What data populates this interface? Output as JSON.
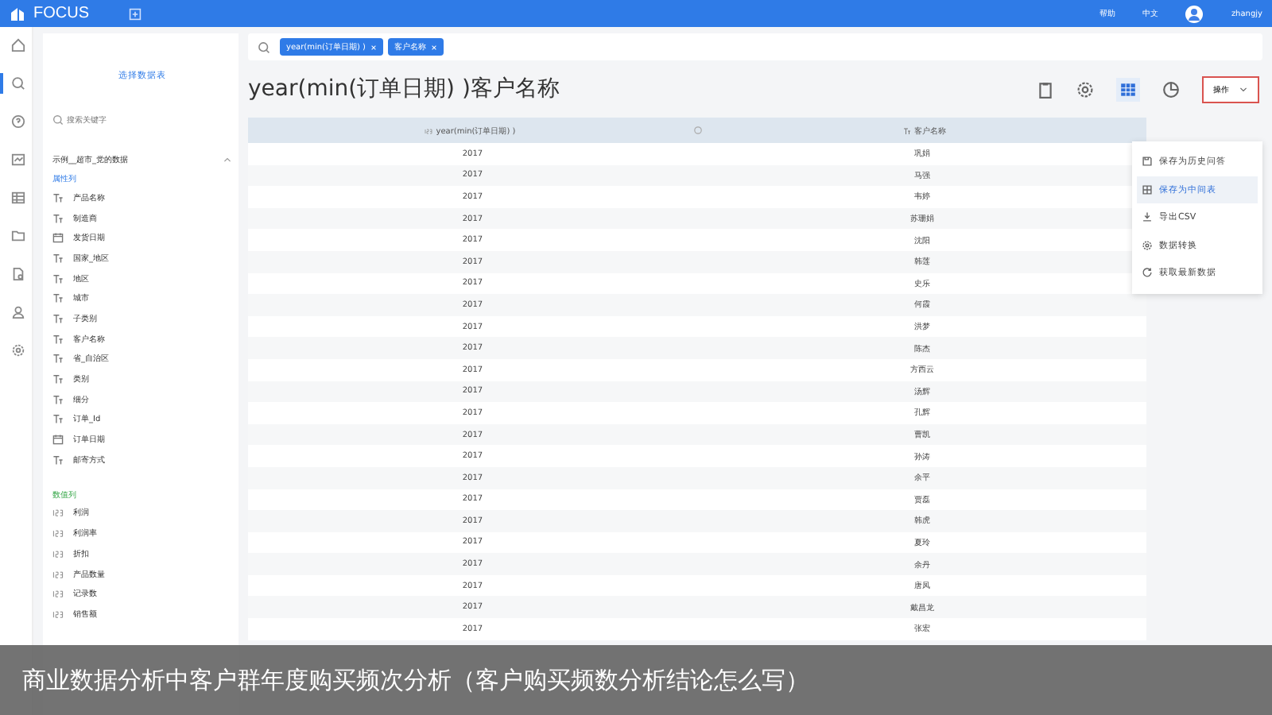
{
  "topbar": {
    "logo": "FOCUS",
    "links": [
      "帮助",
      "中文"
    ],
    "user": "zhangjy"
  },
  "nav": [
    {
      "selected": false
    },
    {
      "selected": true
    },
    {
      "selected": false
    },
    {
      "selected": false
    },
    {
      "selected": false
    },
    {
      "selected": false
    },
    {
      "selected": false
    },
    {
      "selected": false
    },
    {
      "selected": false
    }
  ],
  "datasource": {
    "button": "选择数据表",
    "search_placeholder": "搜索关键字",
    "table_name": "示例__超市_党的数据",
    "sections": [
      {
        "label": "属性列",
        "kind": "attr",
        "fields": [
          {
            "name": "产品名称",
            "kind": "text"
          },
          {
            "name": "制造商",
            "kind": "text"
          },
          {
            "name": "发货日期",
            "kind": "date"
          },
          {
            "name": "国家_地区",
            "kind": "text"
          },
          {
            "name": "地区",
            "kind": "text"
          },
          {
            "name": "城市",
            "kind": "text"
          },
          {
            "name": "子类别",
            "kind": "text"
          },
          {
            "name": "客户名称",
            "kind": "text"
          },
          {
            "name": "省_自治区",
            "kind": "text"
          },
          {
            "name": "类别",
            "kind": "text"
          },
          {
            "name": "细分",
            "kind": "text"
          },
          {
            "name": "订单_Id",
            "kind": "text"
          },
          {
            "name": "订单日期",
            "kind": "date"
          },
          {
            "name": "邮寄方式",
            "kind": "text"
          }
        ]
      },
      {
        "label": "数值列",
        "kind": "measure",
        "fields": [
          {
            "name": "利润",
            "kind": "number"
          },
          {
            "name": "利润率",
            "kind": "number"
          },
          {
            "name": "折扣",
            "kind": "number"
          },
          {
            "name": "产品数量",
            "kind": "number"
          },
          {
            "name": "记录数",
            "kind": "number"
          },
          {
            "name": "销售额",
            "kind": "number"
          }
        ]
      }
    ]
  },
  "query": {
    "tags": [
      "year(min(订单日期) )",
      "客户名称"
    ]
  },
  "title": "year(min(订单日期) )客户名称",
  "toolbar": {
    "button": "操作"
  },
  "menu": [
    {
      "label": "保存为历史问答",
      "selected": false
    },
    {
      "label": "保存为中间表",
      "selected": true
    },
    {
      "label": "导出CSV",
      "selected": false
    },
    {
      "label": "数据转换",
      "selected": false
    },
    {
      "label": "获取最新数据",
      "selected": false
    }
  ],
  "table": {
    "columns": [
      "year(min(订单日期) )",
      "客户名称"
    ],
    "rows": [
      [
        "2017",
        "巩娟"
      ],
      [
        "2017",
        "马强"
      ],
      [
        "2017",
        "韦婷"
      ],
      [
        "2017",
        "苏珊娟"
      ],
      [
        "2017",
        "沈阳"
      ],
      [
        "2017",
        "韩莲"
      ],
      [
        "2017",
        "史乐"
      ],
      [
        "2017",
        "何霞"
      ],
      [
        "2017",
        "洪梦"
      ],
      [
        "2017",
        "陈杰"
      ],
      [
        "2017",
        "方西云"
      ],
      [
        "2017",
        "汤辉"
      ],
      [
        "2017",
        "孔辉"
      ],
      [
        "2017",
        "曹凯"
      ],
      [
        "2017",
        "孙涛"
      ],
      [
        "2017",
        "余平"
      ],
      [
        "2017",
        "贾磊"
      ],
      [
        "2017",
        "韩虎"
      ],
      [
        "2017",
        "夏玲"
      ],
      [
        "2017",
        "余丹"
      ],
      [
        "2017",
        "唐凤"
      ],
      [
        "2017",
        "戴昌龙"
      ],
      [
        "2017",
        "张宏"
      ]
    ]
  },
  "caption": "商业数据分析中客户群年度购买频次分析（客户购买频数分析结论怎么写）"
}
